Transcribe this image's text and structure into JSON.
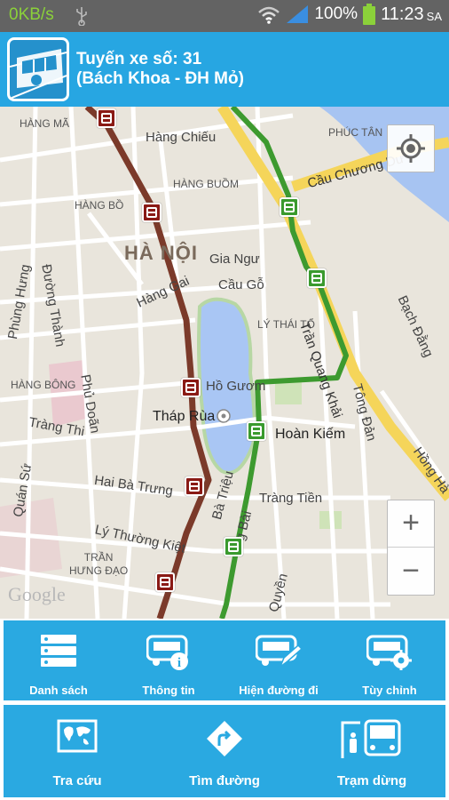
{
  "status_bar": {
    "network_speed": "0KB/s",
    "battery_percent": "100%",
    "time": "11:23",
    "ampm": "SA",
    "icons": [
      "usb-icon",
      "wifi-icon",
      "signal-icon",
      "battery-icon"
    ]
  },
  "header": {
    "title_line1": "Tuyến xe số: 31",
    "title_line2": "(Bách Khoa - ĐH Mỏ)",
    "logo_icon": "tram-icon",
    "color": "#27a6e2"
  },
  "map": {
    "labels": {
      "hang_ma": "HÀNG MÃ",
      "hang_chieu": "Hàng Chiếu",
      "phuc_tan": "PHÚC TÂN",
      "cau_chuong_duong": "Cầu Chương Dư",
      "hang_buom": "HÀNG BUỒM",
      "hang_bo": "HÀNG BỒ",
      "ha_noi": "HÀ NỘI",
      "gia_ngu": "Gia Ngư",
      "cau_go": "Cầu Gỗ",
      "hang_gai": "Hàng Gai",
      "ly_thai_to": "LÝ THÁI TỔ",
      "tran_quang_khai": "Trần Quang Khải",
      "bach_dang": "Bạch Đằng",
      "phung_hung": "Phùng Hưng",
      "duong_thanh": "Đường Thành",
      "hang_bong": "HÀNG BÔNG",
      "ho_guom": "Hồ Gươm",
      "thap_rua": "Tháp Rùa",
      "hoan_kiem": "Hoàn Kiếm",
      "tong_dan": "Tông Đản",
      "hong_ha": "Hồng Hà",
      "phu_doan": "Phủ Doãn",
      "trang_thi": "Tràng Thi",
      "quan_su": "Quán Sứ",
      "hai_ba_trung": "Hai Bà Trưng",
      "ba_trieu": "Bà Triệu",
      "trang_tien": "Tràng Tiền",
      "ly_thuong_kiet": "Lý Thường Kiệt",
      "tran_hung_dao": "TRẦN\nHƯNG ĐẠO",
      "ngo_quyen": "Quyền",
      "dinh_tien_hoang": "g Bài"
    },
    "google_logo": "Google",
    "outbound_route_color": "#7b3a2a",
    "return_route_color": "#3d9a2f",
    "controls": {
      "zoom_in": "+",
      "zoom_out": "−",
      "locate_icon": "crosshair-icon"
    }
  },
  "toolbar_top": [
    {
      "label": "Danh sách",
      "icon": "list-icon"
    },
    {
      "label": "Thông tin",
      "icon": "bus-info-icon"
    },
    {
      "label": "Hiện đường đi",
      "icon": "bus-edit-icon"
    },
    {
      "label": "Tùy chỉnh",
      "icon": "bus-settings-icon"
    }
  ],
  "toolbar_bottom": [
    {
      "label": "Tra cứu",
      "icon": "world-map-icon"
    },
    {
      "label": "Tìm đường",
      "icon": "directions-icon"
    },
    {
      "label": "Trạm dừng",
      "icon": "bus-stop-icon"
    }
  ]
}
